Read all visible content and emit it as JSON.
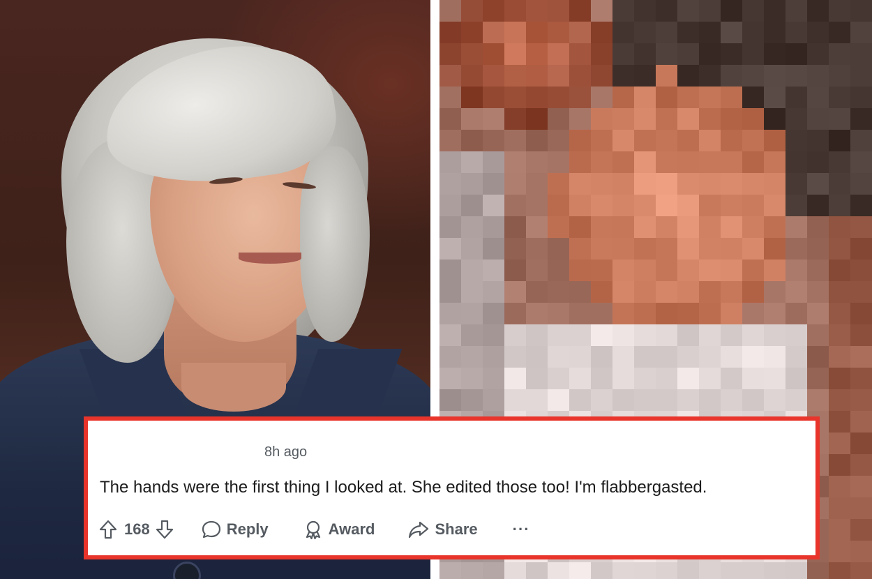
{
  "comment": {
    "timestamp": "8h ago",
    "text": "The hands were the first thing I looked at. She edited those too! I'm flabbergasted.",
    "vote_count": "168",
    "actions": {
      "reply": "Reply",
      "award": "Award",
      "share": "Share",
      "more": "···"
    }
  },
  "icons": {
    "upvote": "arrow-up-icon",
    "downvote": "arrow-down-icon",
    "reply": "speech-bubble-icon",
    "award": "award-ribbon-icon",
    "share": "share-arrow-icon",
    "more": "ellipsis-icon"
  },
  "colors": {
    "highlight_border": "#e8342a",
    "action_text": "#555b61",
    "comment_text": "#1c1c1c"
  }
}
